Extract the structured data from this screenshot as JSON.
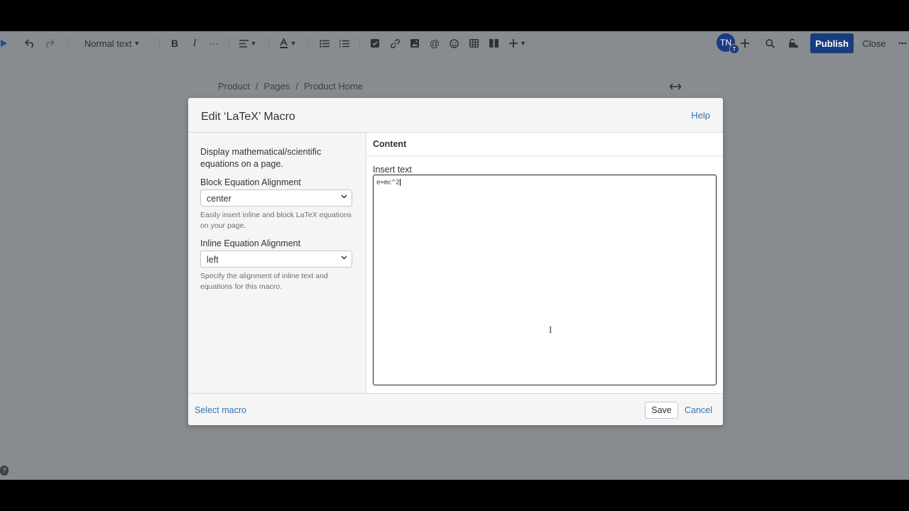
{
  "toolbar": {
    "text_style": "Normal text",
    "bold": "B",
    "italic": "I",
    "more": "···",
    "mention": "@",
    "avatar_initials": "TN",
    "avatar_badge": "T",
    "publish_label": "Publish",
    "close_label": "Close"
  },
  "breadcrumb": {
    "items": [
      "Product",
      "Pages",
      "Product Home"
    ],
    "separator": "/"
  },
  "dialog": {
    "title": "Edit ‘LaTeX’ Macro",
    "help_label": "Help",
    "description": "Display mathematical/scientific equations on a page.",
    "block_alignment": {
      "label": "Block Equation Alignment",
      "value": "center",
      "hint": "Easily insert inline and block LaTeX equations on your page."
    },
    "inline_alignment": {
      "label": "Inline Equation Alignment",
      "value": "left",
      "hint": "Specify the alignment of inline text and equations for this macro."
    },
    "content_tab": "Content",
    "insert_text_label": "Insert text",
    "insert_text_value": "e=mc^2",
    "select_macro_label": "Select macro",
    "save_label": "Save",
    "cancel_label": "Cancel"
  },
  "colors": {
    "overlay_background": "#888b8f",
    "publish_button": "#173d80",
    "link": "#3572b0"
  }
}
